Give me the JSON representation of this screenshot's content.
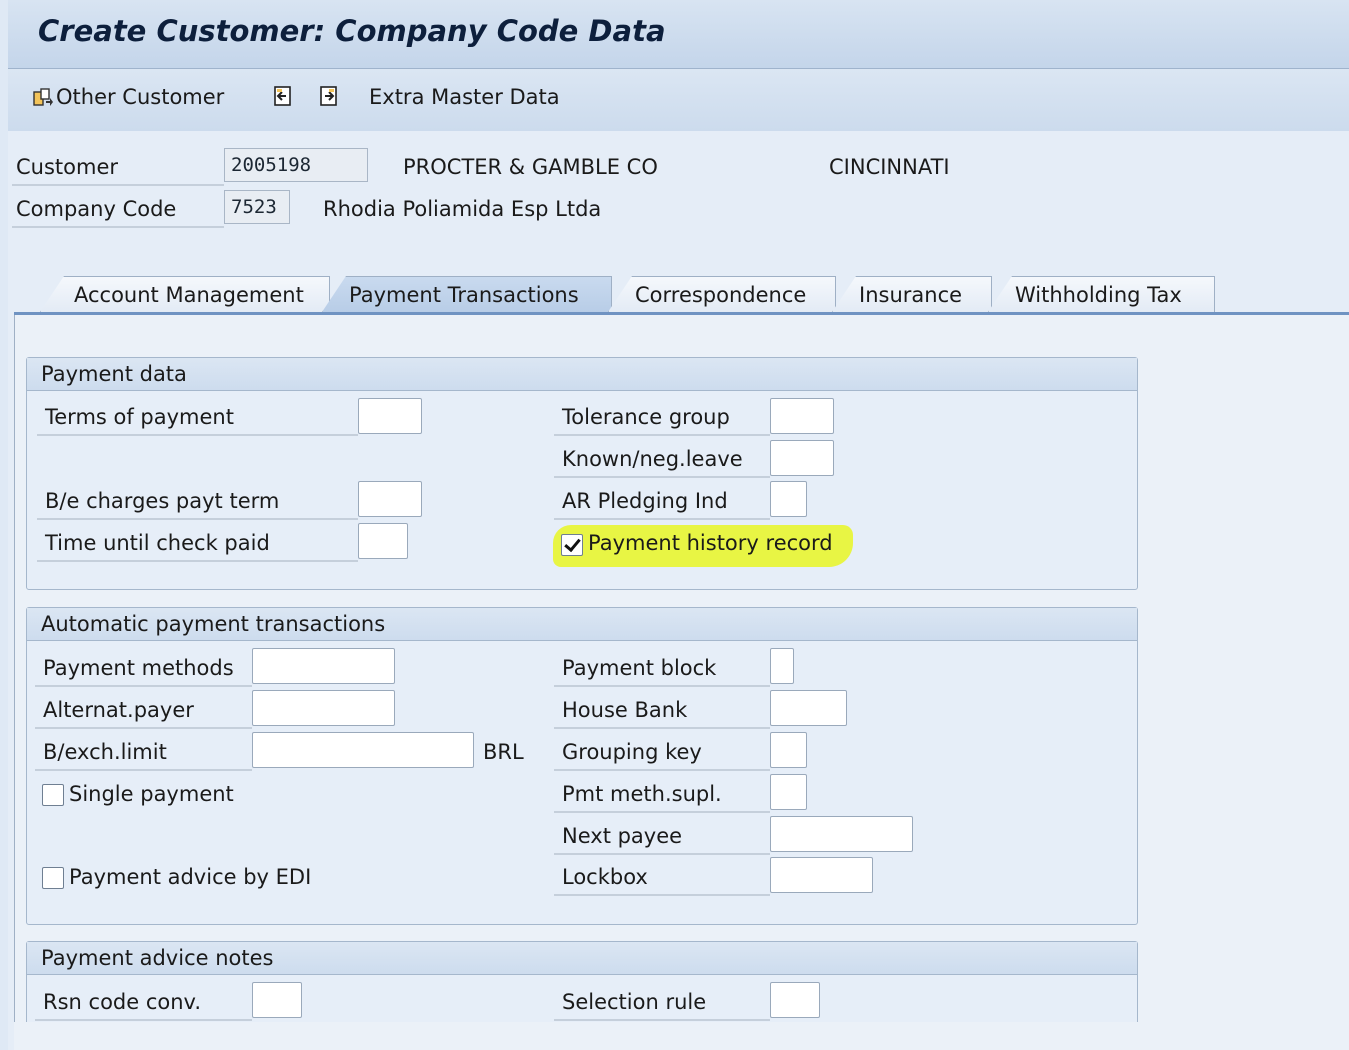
{
  "window": {
    "title": "Create Customer: Company Code Data"
  },
  "toolbar": {
    "other_customer_label": "Other Customer",
    "extra_master_data_label": "Extra Master Data"
  },
  "header": {
    "customer_label": "Customer",
    "customer_value": "2005198",
    "customer_name": "PROCTER & GAMBLE CO",
    "customer_city": "CINCINNATI",
    "company_code_label": "Company Code",
    "company_code_value": "7523",
    "company_name": "Rhodia Poliamida Esp Ltda"
  },
  "tabs": [
    {
      "label": "Account Management"
    },
    {
      "label": "Payment Transactions",
      "active": true
    },
    {
      "label": "Correspondence"
    },
    {
      "label": "Insurance"
    },
    {
      "label": "Withholding Tax"
    }
  ],
  "payment_data": {
    "title": "Payment data",
    "terms_of_payment": "Terms of payment",
    "be_charges_payt_term": "B/e charges payt term",
    "time_until_check_paid": "Time until check paid",
    "tolerance_group": "Tolerance group",
    "known_neg_leave": "Known/neg.leave",
    "ar_pledging_ind": "AR Pledging Ind",
    "payment_history_record": "Payment history record",
    "payment_history_record_checked": true
  },
  "automatic_payment": {
    "title": "Automatic payment transactions",
    "payment_methods": "Payment methods",
    "alternat_payer": "Alternat.payer",
    "bexch_limit": "B/exch.limit",
    "currency": "BRL",
    "single_payment": "Single payment",
    "single_payment_checked": false,
    "payment_advice_by_edi": "Payment advice by EDI",
    "payment_advice_by_edi_checked": false,
    "payment_block": "Payment block",
    "house_bank": "House Bank",
    "grouping_key": "Grouping key",
    "pmt_meth_supl": "Pmt meth.supl.",
    "next_payee": "Next payee",
    "lockbox": "Lockbox"
  },
  "payment_advice_notes": {
    "title": "Payment advice notes",
    "rsn_code_conv": "Rsn code conv.",
    "selection_rule": "Selection rule"
  },
  "colors": {
    "highlight": "#e8f43a",
    "title_text": "#0d1f3c",
    "tab_active": "#b8cde7"
  }
}
